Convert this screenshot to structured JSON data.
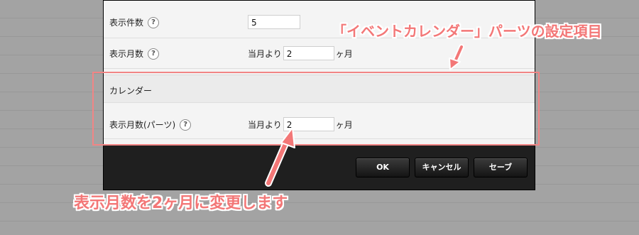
{
  "form": {
    "rows": [
      {
        "label": "表示件数",
        "value": "5"
      },
      {
        "label": "表示月数",
        "prefix": "当月より",
        "value": "2",
        "suffix": "ヶ月"
      }
    ],
    "section_title": "カレンダー",
    "parts_row": {
      "label": "表示月数(パーツ)",
      "prefix": "当月より",
      "value": "2",
      "suffix": "ヶ月"
    },
    "help_glyph": "?"
  },
  "buttons": {
    "ok": "OK",
    "cancel": "キャンセル",
    "save": "セーブ"
  },
  "annotations": {
    "top": "「イベントカレンダー」パーツの設定項目",
    "bottom": "表示月数を2ヶ月に変更します",
    "color": "#f37777"
  }
}
